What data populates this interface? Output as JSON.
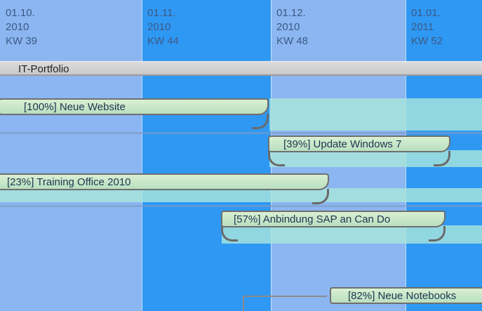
{
  "timeline": {
    "columns": [
      {
        "date": "01.10.",
        "year": "2010",
        "week": "KW 39"
      },
      {
        "date": "01.11.",
        "year": "2010",
        "week": "KW 44"
      },
      {
        "date": "01.12.",
        "year": "2010",
        "week": "KW 48"
      },
      {
        "date": "01.01.",
        "year": "2011",
        "week": "KW 52"
      }
    ]
  },
  "portfolio": {
    "label": "IT-Portfolio"
  },
  "tasks": [
    {
      "label": "[100%] Neue Website",
      "progress": 100
    },
    {
      "label": "[39%] Update Windows 7",
      "progress": 39
    },
    {
      "label": "[23%] Training Office 2010",
      "progress": 23
    },
    {
      "label": "[57%] Anbindung SAP an Can Do",
      "progress": 57
    },
    {
      "label": "[82%] Neue Notebooks",
      "progress": 82
    }
  ],
  "colors": {
    "light_column": "#8bb6f1",
    "dark_column": "#2f98f3",
    "bar_fill": "#c4e6c8",
    "bar_border": "#6f6f6f",
    "header_text": "#3d5a86"
  }
}
